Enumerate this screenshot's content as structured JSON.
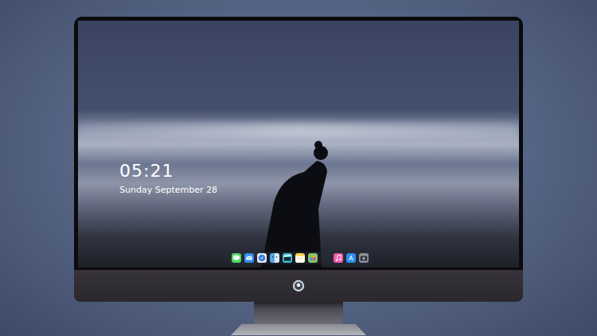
{
  "lock_screen": {
    "time": "05:21",
    "date": "Sunday September 28"
  },
  "dock": {
    "items": [
      {
        "kind": "messages",
        "color": "#4cd964"
      },
      {
        "kind": "mail",
        "color": "#2f8ef0"
      },
      {
        "kind": "safari",
        "color": "#e8ecf2"
      },
      {
        "kind": "finder",
        "color": "#5aa6e8"
      },
      {
        "kind": "video",
        "color": "#41c3d8"
      },
      {
        "kind": "notes",
        "color": "#f7d64a"
      },
      {
        "kind": "photos",
        "color": "#7fc66b"
      },
      {
        "kind": "music",
        "color": "#f25aa8"
      },
      {
        "kind": "store",
        "color": "#2b8ff2"
      },
      {
        "kind": "camera",
        "color": "#8d939c"
      }
    ]
  }
}
